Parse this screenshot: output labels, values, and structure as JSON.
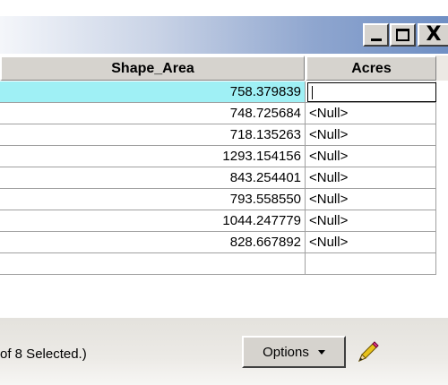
{
  "titlebar": {
    "minimize_icon": "minimize-icon",
    "maximize_icon": "maximize-icon",
    "close_label": "X"
  },
  "table": {
    "columns": [
      "Shape_Area",
      "Acres"
    ],
    "rows": [
      {
        "shape_area": "758.379839",
        "acres": "",
        "selected": true,
        "editing": true
      },
      {
        "shape_area": "748.725684",
        "acres": "<Null>"
      },
      {
        "shape_area": "718.135263",
        "acres": "<Null>"
      },
      {
        "shape_area": "1293.154156",
        "acres": "<Null>"
      },
      {
        "shape_area": "843.254401",
        "acres": "<Null>"
      },
      {
        "shape_area": "793.558550",
        "acres": "<Null>"
      },
      {
        "shape_area": "1044.247779",
        "acres": "<Null>"
      },
      {
        "shape_area": "828.667892",
        "acres": "<Null>"
      },
      {
        "shape_area": "",
        "acres": ""
      }
    ]
  },
  "bottom": {
    "status_text": "of 8 Selected.)",
    "options_label": "Options",
    "editor_icon": "pencil-icon"
  },
  "colors": {
    "selected_row": "#9ff0f5",
    "titlebar_accent": "#6f8fc4",
    "button_face": "#d6d3ce"
  }
}
